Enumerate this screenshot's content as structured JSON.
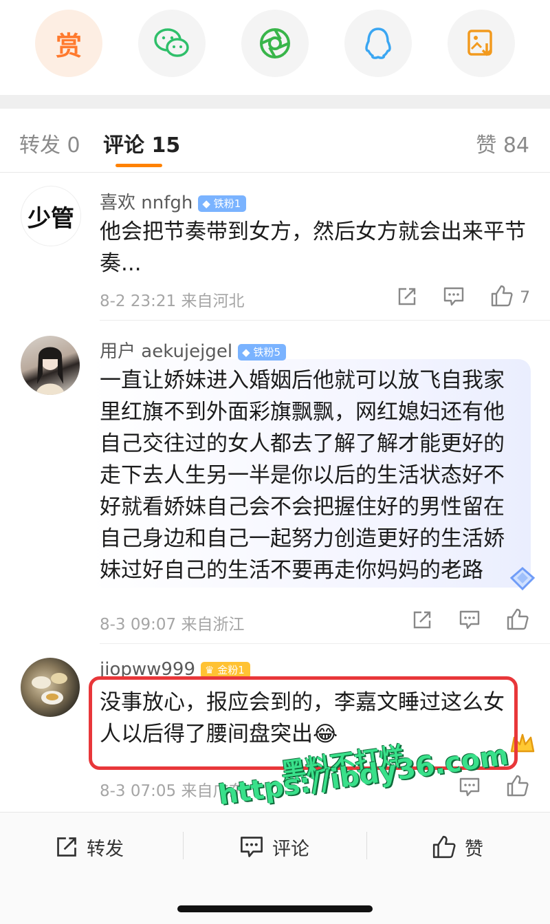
{
  "share_row": {
    "items": [
      {
        "icon": "reward-icon",
        "label": "赏"
      },
      {
        "icon": "wechat-icon"
      },
      {
        "icon": "moments-icon"
      },
      {
        "icon": "qq-icon"
      },
      {
        "icon": "save-image-icon"
      }
    ]
  },
  "tabs": {
    "repost": "转发 0",
    "comments": "评论 15",
    "likes": "赞 84"
  },
  "comments": [
    {
      "avatar_text": "少管",
      "username": "喜欢 nnfgh",
      "badge": "铁粉1",
      "line1": "他会把节奏带到女方，然后女方就会出来平节",
      "line2": "奏...",
      "meta": "8-2 23:21 来自河北",
      "like_count": "7"
    },
    {
      "username": "用户 aekujejgel",
      "badge": "铁粉5",
      "lines": [
        "一直让娇妹进入婚姻后他就可以放飞自我家",
        "里红旗不到外面彩旗飘飘，网红媳妇还有他",
        "自己交往过的女人都去了解了解才能更好的",
        "走下去人生另一半是你以后的生活状态好不",
        "好就看娇妹自己会不会把握住好的男性留在",
        "自己身边和自己一起努力创造更好的生活娇",
        "妹过好自己的生活不要再走你妈妈的老路"
      ],
      "meta": "8-3 09:07 来自浙江"
    },
    {
      "username": "jiopww999",
      "badge": "金粉1",
      "line1": "没事放心，报应会到的，李嘉文睡过这么女",
      "line2": "人以后得了腰间盘突出",
      "emoji": "😂",
      "meta": "8-3 07:05 来自广东"
    }
  ],
  "watermark": {
    "line1": "黑料不打烊",
    "line2": "https://ibdy36.com"
  },
  "bottom_bar": {
    "repost": "转发",
    "comment": "评论",
    "like": "赞"
  }
}
